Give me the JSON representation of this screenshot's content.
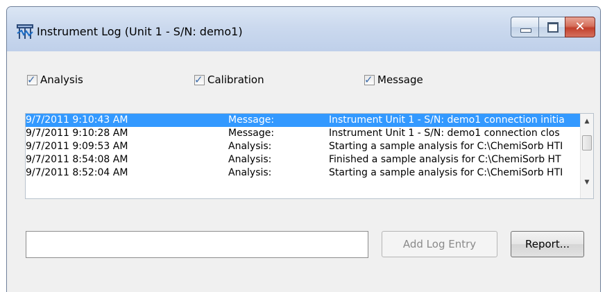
{
  "window": {
    "title": "Instrument Log (Unit 1 - S/N: demo1)",
    "close_symbol": "✕"
  },
  "filters": {
    "analysis": {
      "label": "Analysis",
      "checked": true
    },
    "calibration": {
      "label": "Calibration",
      "checked": true
    },
    "message": {
      "label": "Message",
      "checked": true
    },
    "check_symbol": "✓"
  },
  "log": {
    "rows": [
      {
        "time": "9/7/2011 9:10:43 AM",
        "type": "Message:",
        "text": "Instrument Unit 1 - S/N: demo1 connection initia",
        "selected": true
      },
      {
        "time": "9/7/2011 9:10:28 AM",
        "type": "Message:",
        "text": "Instrument Unit 1 - S/N: demo1 connection clos",
        "selected": false
      },
      {
        "time": "9/7/2011 9:09:53 AM",
        "type": "Analysis:",
        "text": "Starting a sample analysis for C:\\ChemiSorb HTI",
        "selected": false
      },
      {
        "time": "9/7/2011 8:54:08 AM",
        "type": "Analysis:",
        "text": "Finished a sample analysis for C:\\ChemiSorb HT",
        "selected": false
      },
      {
        "time": "9/7/2011 8:52:04 AM",
        "type": "Analysis:",
        "text": "Starting a sample analysis for C:\\ChemiSorb HTI",
        "selected": false
      }
    ],
    "scroll_up_symbol": "▲",
    "scroll_down_symbol": "▼"
  },
  "entry": {
    "value": "",
    "placeholder": ""
  },
  "buttons": {
    "add_log_entry": "Add Log Entry",
    "report": "Report..."
  },
  "colors": {
    "selection": "#3399ff",
    "disabled_text": "#8a8a8a"
  }
}
